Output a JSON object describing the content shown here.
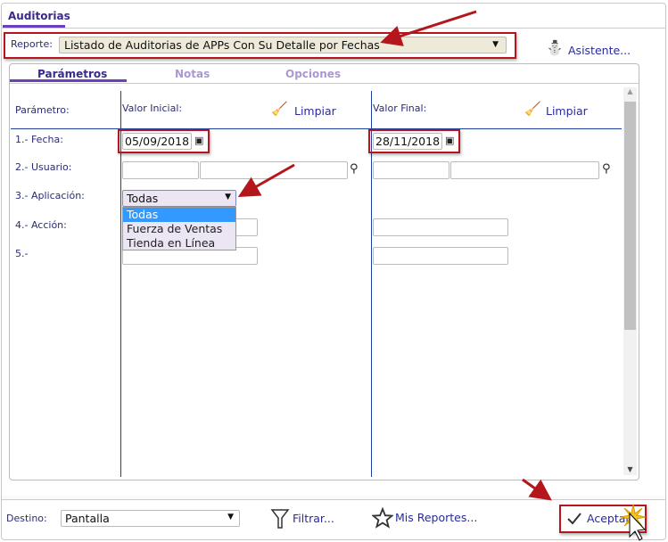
{
  "tabs": {
    "main": "Auditorias"
  },
  "report": {
    "label": "Reporte:",
    "value": "Listado de Auditorias de APPs Con Su Detalle por Fechas",
    "wizard": "Asistente..."
  },
  "inner_tabs": [
    "Parámetros",
    "Notas",
    "Opciones"
  ],
  "headers": {
    "param": "Parámetro:",
    "initial": "Valor Inicial:",
    "final": "Valor Final:",
    "clear": "Limpiar"
  },
  "params": [
    {
      "label": "1.- Fecha:",
      "initial": "05/09/2018",
      "final": "28/11/2018"
    },
    {
      "label": "2.- Usuario:"
    },
    {
      "label": "3.- Aplicación:",
      "initial": "Todas",
      "options": [
        "Todas",
        "Fuerza de Ventas",
        "Tienda en Línea"
      ]
    },
    {
      "label": "4.- Acción:"
    },
    {
      "label": "5.-"
    }
  ],
  "footer": {
    "dest_label": "Destino:",
    "dest_value": "Pantalla",
    "filter": "Filtrar...",
    "my_reports": "Mis Reportes...",
    "accept": "Aceptar"
  },
  "colors": {
    "accent": "#6a3fc0",
    "highlight": "#3399ff",
    "annotation": "#b4161b",
    "link": "#2a2a9a"
  }
}
